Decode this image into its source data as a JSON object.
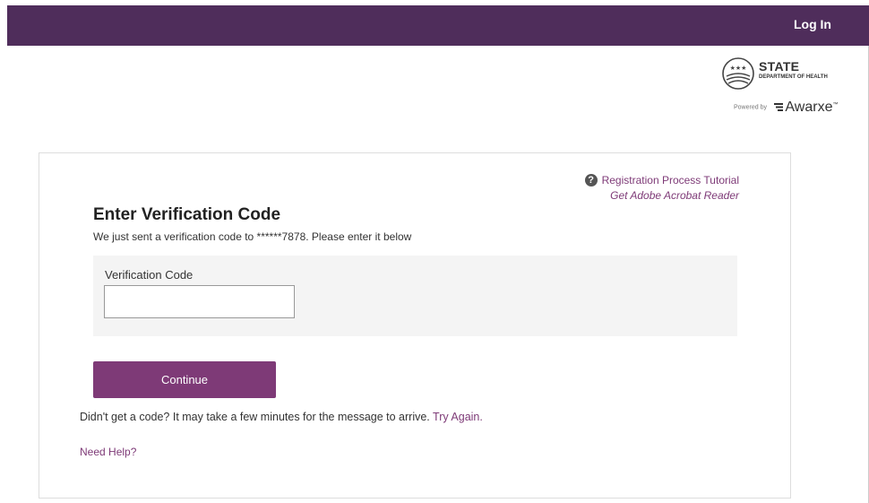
{
  "header": {
    "login_label": "Log In"
  },
  "branding": {
    "state_word": "STATE",
    "department_word": "DEPARTMENT OF HEALTH",
    "powered_by": "Powered by",
    "product_name": "Awarxe",
    "trademark": "™"
  },
  "links": {
    "tutorial": "Registration Process Tutorial",
    "acrobat": "Get Adobe Acrobat Reader"
  },
  "form": {
    "title": "Enter Verification Code",
    "subtitle": "We just sent a verification code to ******7878. Please enter it below",
    "code_label": "Verification Code",
    "code_value": "",
    "continue_label": "Continue",
    "resend_text": "Didn't get a code? It may take a few minutes for the message to arrive. ",
    "try_again_label": "Try Again.",
    "need_help_label": "Need Help?"
  },
  "colors": {
    "header_bg": "#4f2d5b",
    "accent": "#7e3a77",
    "panel_bg": "#f4f4f4"
  }
}
